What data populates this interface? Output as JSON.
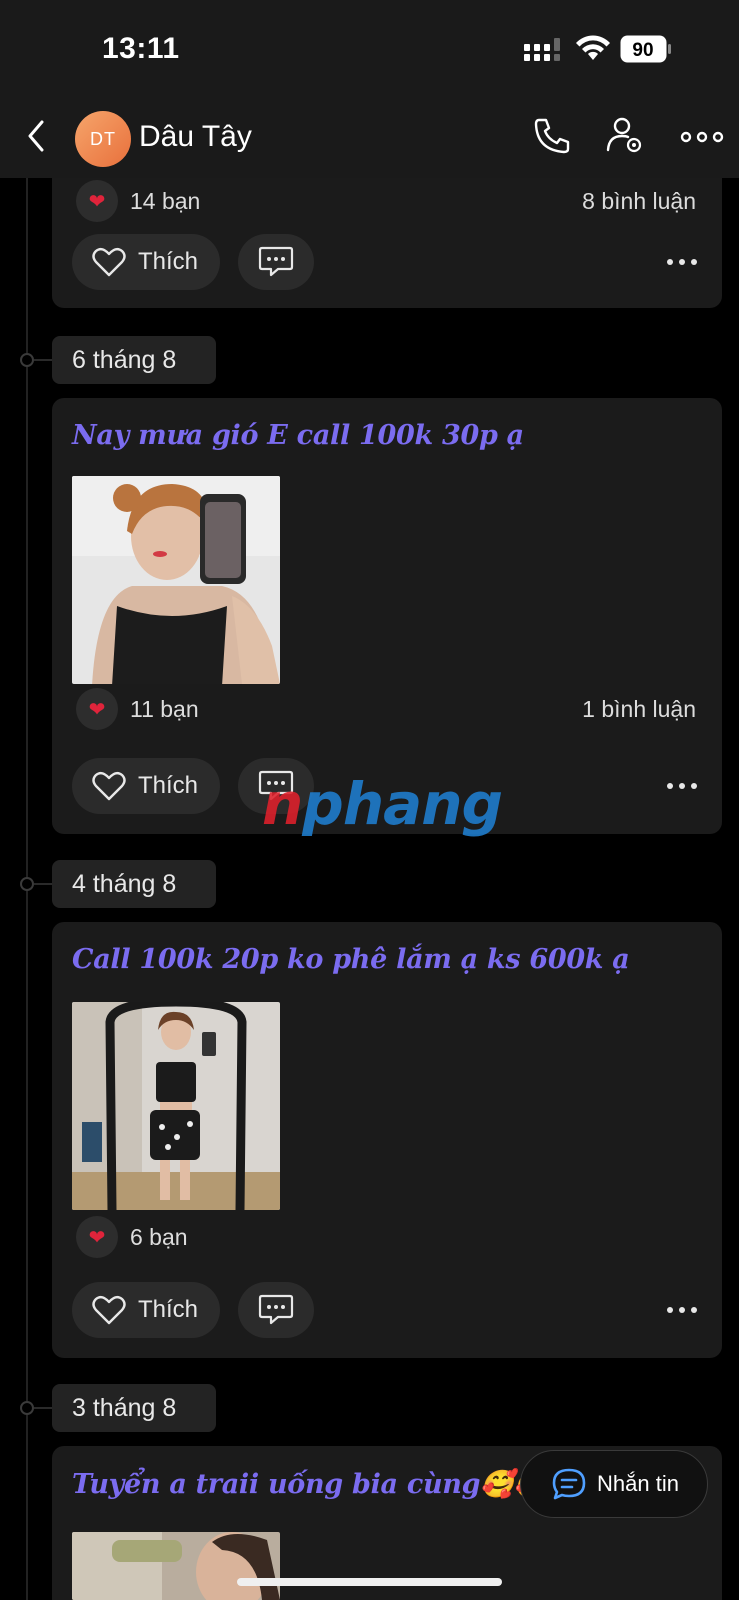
{
  "status_bar": {
    "time": "13:11",
    "battery": "90"
  },
  "header": {
    "avatar_initials": "DT",
    "contact_name": "Dâu Tây"
  },
  "top_card": {
    "reaction_count": "14 bạn",
    "comment_count": "8 bình luận",
    "like_label": "Thích"
  },
  "posts": [
    {
      "date": "6 tháng 8",
      "text": "Nay mưa gió E call 100k 30p ạ",
      "reaction_count": "11 bạn",
      "comment_count": "1 bình luận",
      "like_label": "Thích"
    },
    {
      "date": "4 tháng 8",
      "text": "Call 100k 20p ko phê lắm ạ ks 600k ạ",
      "reaction_count": "6 bạn",
      "comment_count": "",
      "like_label": "Thích"
    },
    {
      "date": "3 tháng 8",
      "text": "Tuyển a traii uống bia cùng🥰🥰🥰"
    }
  ],
  "message_button": {
    "label": "Nhắn tin"
  },
  "watermark": {
    "part1": "n",
    "part2": "phang"
  },
  "colors": {
    "post_text": "#7b6cf0",
    "heart": "#e0243b",
    "avatar": "#ee8a50",
    "background": "#000000",
    "card": "#1b1b1b"
  }
}
